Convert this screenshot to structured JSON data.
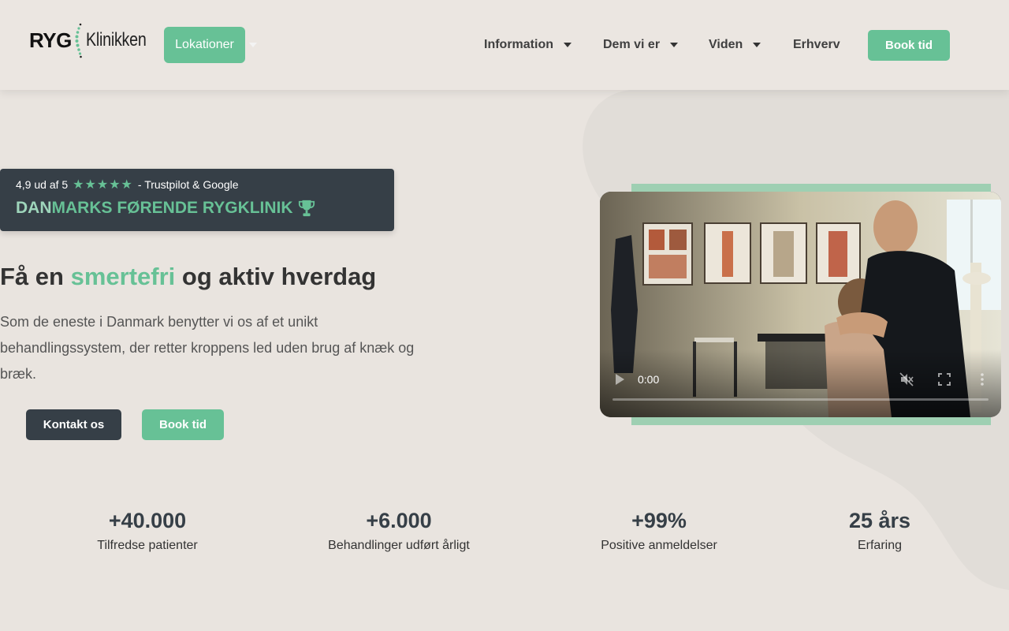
{
  "header": {
    "logo": {
      "part1": "RYG",
      "part2": "Klinikken"
    },
    "locations_button": "Lokationer",
    "nav": [
      {
        "label": "Information",
        "has_dropdown": true
      },
      {
        "label": "Dem vi er",
        "has_dropdown": true
      },
      {
        "label": "Viden",
        "has_dropdown": true
      },
      {
        "label": "Erhverv",
        "has_dropdown": false
      }
    ],
    "book_button": "Book tid"
  },
  "hero": {
    "badge": {
      "rating": "4,9 ud af 5",
      "stars": "★★★★★",
      "source": "- Trustpilot & Google",
      "headline_part1": "DAN",
      "headline_part2": "MARKS FØRENDE RYGKLINIK",
      "icon": "trophy-icon"
    },
    "title_before": "Få en ",
    "title_highlight": "smertefri",
    "title_after": " og aktiv hverdag",
    "text": "Som de eneste i Danmark benytter vi os af et unikt behandlingssystem, der retter kroppens led uden brug af knæk og bræk.",
    "contact_button": "Kontakt os",
    "book_button": "Book tid"
  },
  "video": {
    "time": "0:00",
    "muted": true,
    "progress": 0,
    "icons": [
      "play-icon",
      "muted-icon",
      "fullscreen-icon",
      "more-options-icon"
    ]
  },
  "stats": [
    {
      "value": "+40.000",
      "label": "Tilfredse patienter"
    },
    {
      "value": "+6.000",
      "label": "Behandlinger udført årligt"
    },
    {
      "value": "+99%",
      "label": "Positive anmeldelser"
    },
    {
      "value": "25 års",
      "label": "Erfaring"
    }
  ],
  "colors": {
    "accent": "#67c196",
    "accent_light": "#9ed5bb",
    "dark": "#363f47",
    "background": "#e9e4df"
  }
}
